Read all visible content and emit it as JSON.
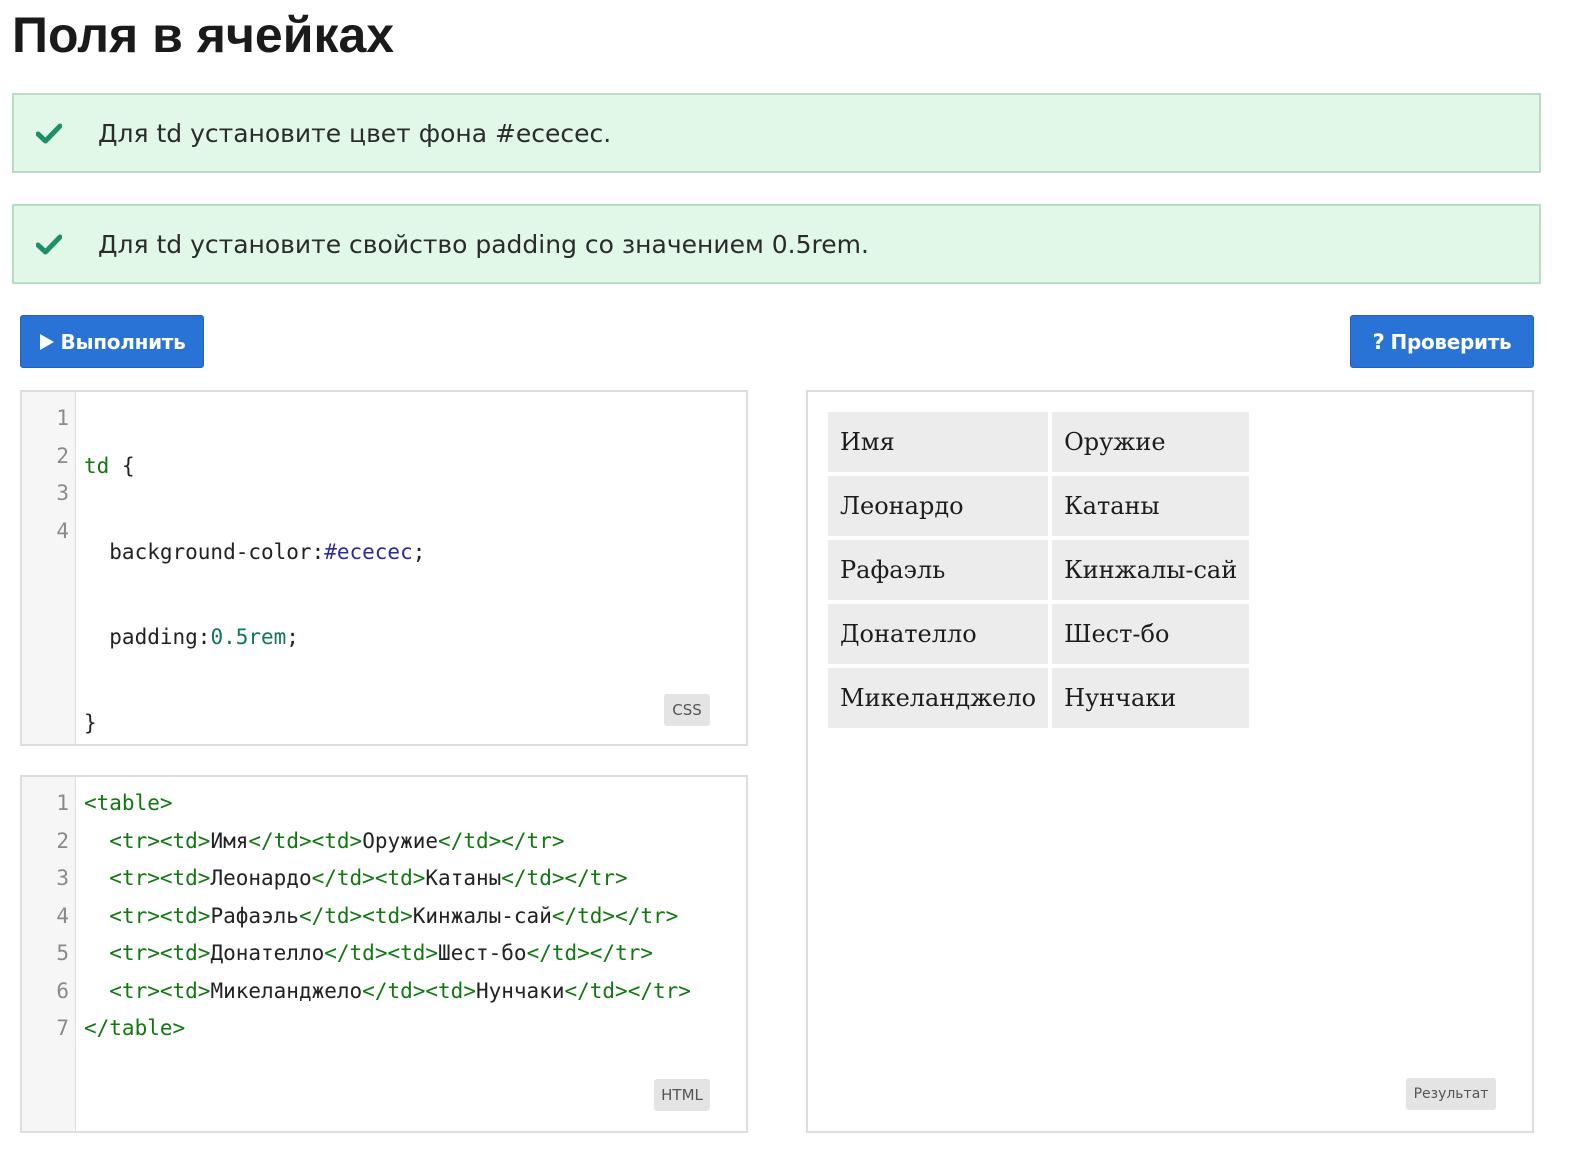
{
  "page": {
    "title": "Поля в ячейках"
  },
  "tasks": [
    {
      "text": "Для td установите цвет фона #ececec.",
      "status": "done",
      "icon": "checkmark-icon"
    },
    {
      "text": "Для td установите свойство padding со значением 0.5rem.",
      "status": "done",
      "icon": "checkmark-icon"
    }
  ],
  "toolbar": {
    "run_label": "Выполнить",
    "run_icon": "play-icon",
    "check_label": "Проверить",
    "check_icon": "question-icon"
  },
  "css_editor": {
    "badge": "CSS",
    "line_numbers": [
      "1",
      "2",
      "3",
      "4"
    ],
    "lines": [
      {
        "selector": "td",
        "brace": " {"
      },
      {
        "property": "  background-color:",
        "value": "#ececec",
        "end": ";"
      },
      {
        "property": "  padding:",
        "value": "0.5rem",
        "end": ";"
      },
      {
        "brace": "}"
      }
    ]
  },
  "html_editor": {
    "badge": "HTML",
    "line_numbers": [
      "1",
      "2",
      "3",
      "4",
      "5",
      "6",
      "7"
    ],
    "open_table": "<table>",
    "close_table": "</table>",
    "rows": [
      {
        "c1": "Имя",
        "c2": "Оружие"
      },
      {
        "c1": "Леонардо",
        "c2": "Катаны"
      },
      {
        "c1": "Рафаэль",
        "c2": "Кинжалы-сай"
      },
      {
        "c1": "Донателло",
        "c2": "Шест-бо"
      },
      {
        "c1": "Микеланджело",
        "c2": "Нунчаки"
      }
    ],
    "tags": {
      "indent": "  ",
      "tr_open": "<tr>",
      "td_open": "<td>",
      "td_close": "</td>",
      "tr_close": "</tr>"
    }
  },
  "result": {
    "badge": "Результат",
    "rows": [
      [
        "Имя",
        "Оружие"
      ],
      [
        "Леонардо",
        "Катаны"
      ],
      [
        "Рафаэль",
        "Кинжалы-сай"
      ],
      [
        "Донателло",
        "Шест-бо"
      ],
      [
        "Микеланджело",
        "Нунчаки"
      ]
    ]
  },
  "colors": {
    "task_bg": "#e1f8e8",
    "task_border": "#b9dcc3",
    "check_color": "#1f8f6a",
    "button_bg": "#2a73d6",
    "cell_bg": "#ececec"
  }
}
